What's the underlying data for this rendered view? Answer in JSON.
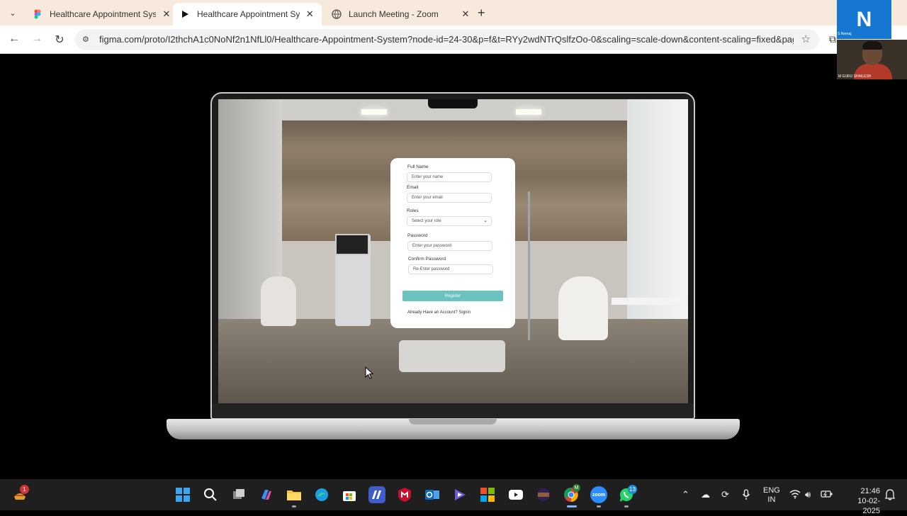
{
  "browser": {
    "tabs": [
      {
        "label": "Healthcare Appointment System",
        "icon": "figma-icon",
        "active": false
      },
      {
        "label": "Healthcare Appointment System",
        "icon": "play-icon",
        "active": true
      },
      {
        "label": "Launch Meeting - Zoom",
        "icon": "globe-icon",
        "active": false
      }
    ],
    "url": "figma.com/proto/I2thchA1c0NoNf2n1NfLl0/Healthcare-Appointment-System?node-id=24-30&p=f&t=RYy2wdNTrQslfzOo-0&scaling=scale-down&content-scaling=fixed&pag..."
  },
  "zoom": {
    "tile_initial": "N",
    "tile_name": "S.Neeraj",
    "video_name": "M GURU SHAILESH"
  },
  "form": {
    "full_name_label": "Full Name",
    "full_name_placeholder": "Enter your name",
    "email_label": "Email",
    "email_placeholder": "Enter your email",
    "roles_label": "Roles",
    "roles_placeholder": "Select your role",
    "password_label": "Password",
    "password_placeholder": "Enter your password",
    "confirm_label": "Confirm Password",
    "confirm_placeholder": "Re-Enter password",
    "register_label": "Register",
    "signin_text": "Already Have an Account? Signin",
    "accent_color": "#6cc3bd"
  },
  "taskbar": {
    "notification_badge": "1",
    "whatsapp_badge": "13",
    "lang_line1": "ENG",
    "lang_line2": "IN",
    "time": "21:46",
    "date": "10-02-2025"
  }
}
